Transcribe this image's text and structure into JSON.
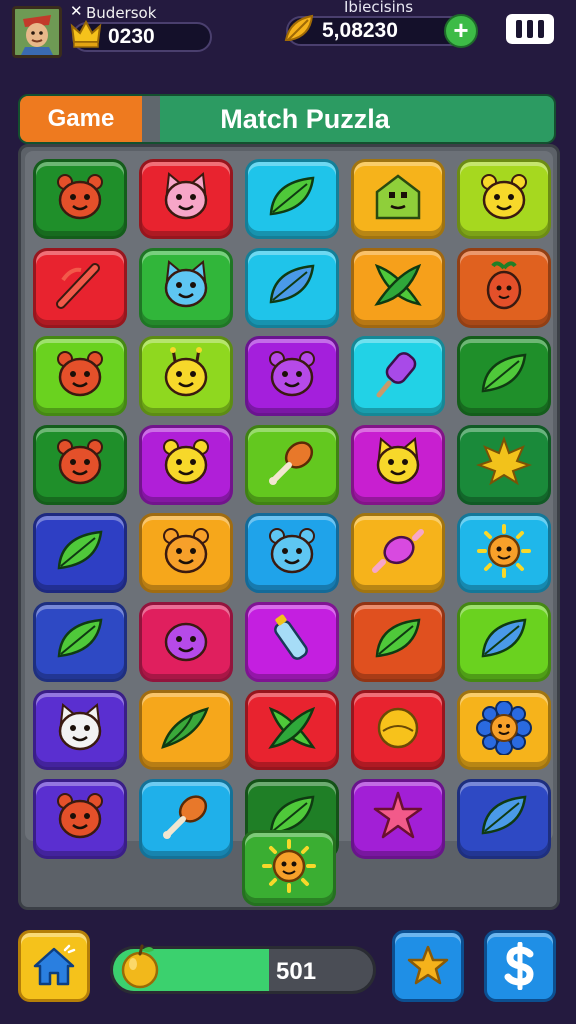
{
  "hud": {
    "player_mark": "✕",
    "player_name": "Budersok",
    "score": "0230",
    "coins_title": "Ibiecisins",
    "coins": "5,08230",
    "add_label": "+"
  },
  "title_bar": {
    "tab_label": "Game",
    "title": "Match Puzzla"
  },
  "board": {
    "rows": 8,
    "cols": 5,
    "tiles": [
      {
        "color": "#1f8f2a",
        "icon": "red-bear-face-icon"
      },
      {
        "color": "#e8232f",
        "icon": "pink-pig-face-icon"
      },
      {
        "color": "#1fc4ea",
        "icon": "green-leaf-icon"
      },
      {
        "color": "#f6b31b",
        "icon": "green-house-face-icon"
      },
      {
        "color": "#a6d81f",
        "icon": "yellow-bear-face-icon"
      },
      {
        "color": "#e8232f",
        "icon": "red-stick-icon"
      },
      {
        "color": "#31b63a",
        "icon": "blue-cat-face-icon"
      },
      {
        "color": "#1fc4ea",
        "icon": "blue-leaf-icon"
      },
      {
        "color": "#f6a01b",
        "icon": "crossed-leaves-icon"
      },
      {
        "color": "#e0611f",
        "icon": "red-fruit-face-icon"
      },
      {
        "color": "#6ad21f",
        "icon": "red-bear-face-icon"
      },
      {
        "color": "#8fd81f",
        "icon": "yellow-giraffe-face-icon"
      },
      {
        "color": "#a41fdc",
        "icon": "purple-mouse-face-icon"
      },
      {
        "color": "#22d2e6",
        "icon": "purple-popsicle-icon"
      },
      {
        "color": "#1f8f2a",
        "icon": "green-leaf-icon"
      },
      {
        "color": "#1f8f2a",
        "icon": "red-bear-face-icon"
      },
      {
        "color": "#b01fd8",
        "icon": "yellow-bear-face-icon"
      },
      {
        "color": "#63c81f",
        "icon": "orange-drumstick-icon"
      },
      {
        "color": "#c81fd0",
        "icon": "yellow-cat-face-icon"
      },
      {
        "color": "#1a8a3a",
        "icon": "yellow-maple-leaf-icon"
      },
      {
        "color": "#2e3fc4",
        "icon": "green-leaf-icon"
      },
      {
        "color": "#f6a71b",
        "icon": "orange-bear-face-icon"
      },
      {
        "color": "#1fa3ea",
        "icon": "blue-bear-face-icon"
      },
      {
        "color": "#f6b31b",
        "icon": "pink-candy-icon"
      },
      {
        "color": "#1fb7ea",
        "icon": "orange-sun-face-icon"
      },
      {
        "color": "#2e49c4",
        "icon": "green-leaf-icon"
      },
      {
        "color": "#e01f5e",
        "icon": "purple-blob-face-icon"
      },
      {
        "color": "#c41fe0",
        "icon": "blue-bottle-icon"
      },
      {
        "color": "#e0501f",
        "icon": "green-leaf-icon"
      },
      {
        "color": "#6ad21f",
        "icon": "blue-leaf-icon"
      },
      {
        "color": "#5a2fd0",
        "icon": "white-cat-face-icon"
      },
      {
        "color": "#f6a71b",
        "icon": "green-leaves-icon"
      },
      {
        "color": "#e8232f",
        "icon": "crossed-leaves-icon"
      },
      {
        "color": "#e8232f",
        "icon": "yellow-ball-icon"
      },
      {
        "color": "#f6b31b",
        "icon": "blue-flower-face-icon"
      },
      {
        "color": "#5a2fd0",
        "icon": "red-bear-face-icon"
      },
      {
        "color": "#1fb0ea",
        "icon": "orange-drumstick-icon"
      },
      {
        "color": "#1f7f26",
        "icon": "green-leaf-icon"
      },
      {
        "color": "#a21fd6",
        "icon": "pink-star-icon"
      },
      {
        "color": "#2e49c4",
        "icon": "blue-leaf-icon"
      }
    ],
    "bonus_tile": {
      "color": "#3aae32",
      "icon": "orange-sun-face-icon"
    }
  },
  "bottom_bar": {
    "energy_value": "501",
    "energy_fraction": 0.6
  }
}
